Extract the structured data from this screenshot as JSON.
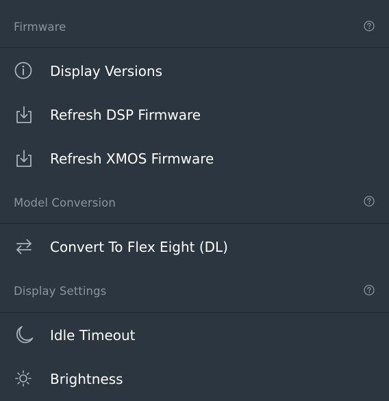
{
  "sections": {
    "firmware": {
      "title": "Firmware",
      "items": [
        {
          "label": "Display Versions",
          "icon": "info-icon"
        },
        {
          "label": "Refresh DSP Firmware",
          "icon": "download-icon"
        },
        {
          "label": "Refresh XMOS Firmware",
          "icon": "download-icon"
        }
      ]
    },
    "model_conversion": {
      "title": "Model Conversion",
      "items": [
        {
          "label": "Convert To Flex Eight (DL)",
          "icon": "swap-arrows-icon"
        }
      ]
    },
    "display_settings": {
      "title": "Display Settings",
      "items": [
        {
          "label": "Idle Timeout",
          "icon": "moon-icon"
        },
        {
          "label": "Brightness",
          "icon": "sun-icon"
        }
      ]
    }
  },
  "colors": {
    "background": "#2b3641",
    "divider": "#1d252d",
    "section_title": "#8b949e",
    "item_label": "#ffffff",
    "icon_stroke": "#aab2ba"
  }
}
